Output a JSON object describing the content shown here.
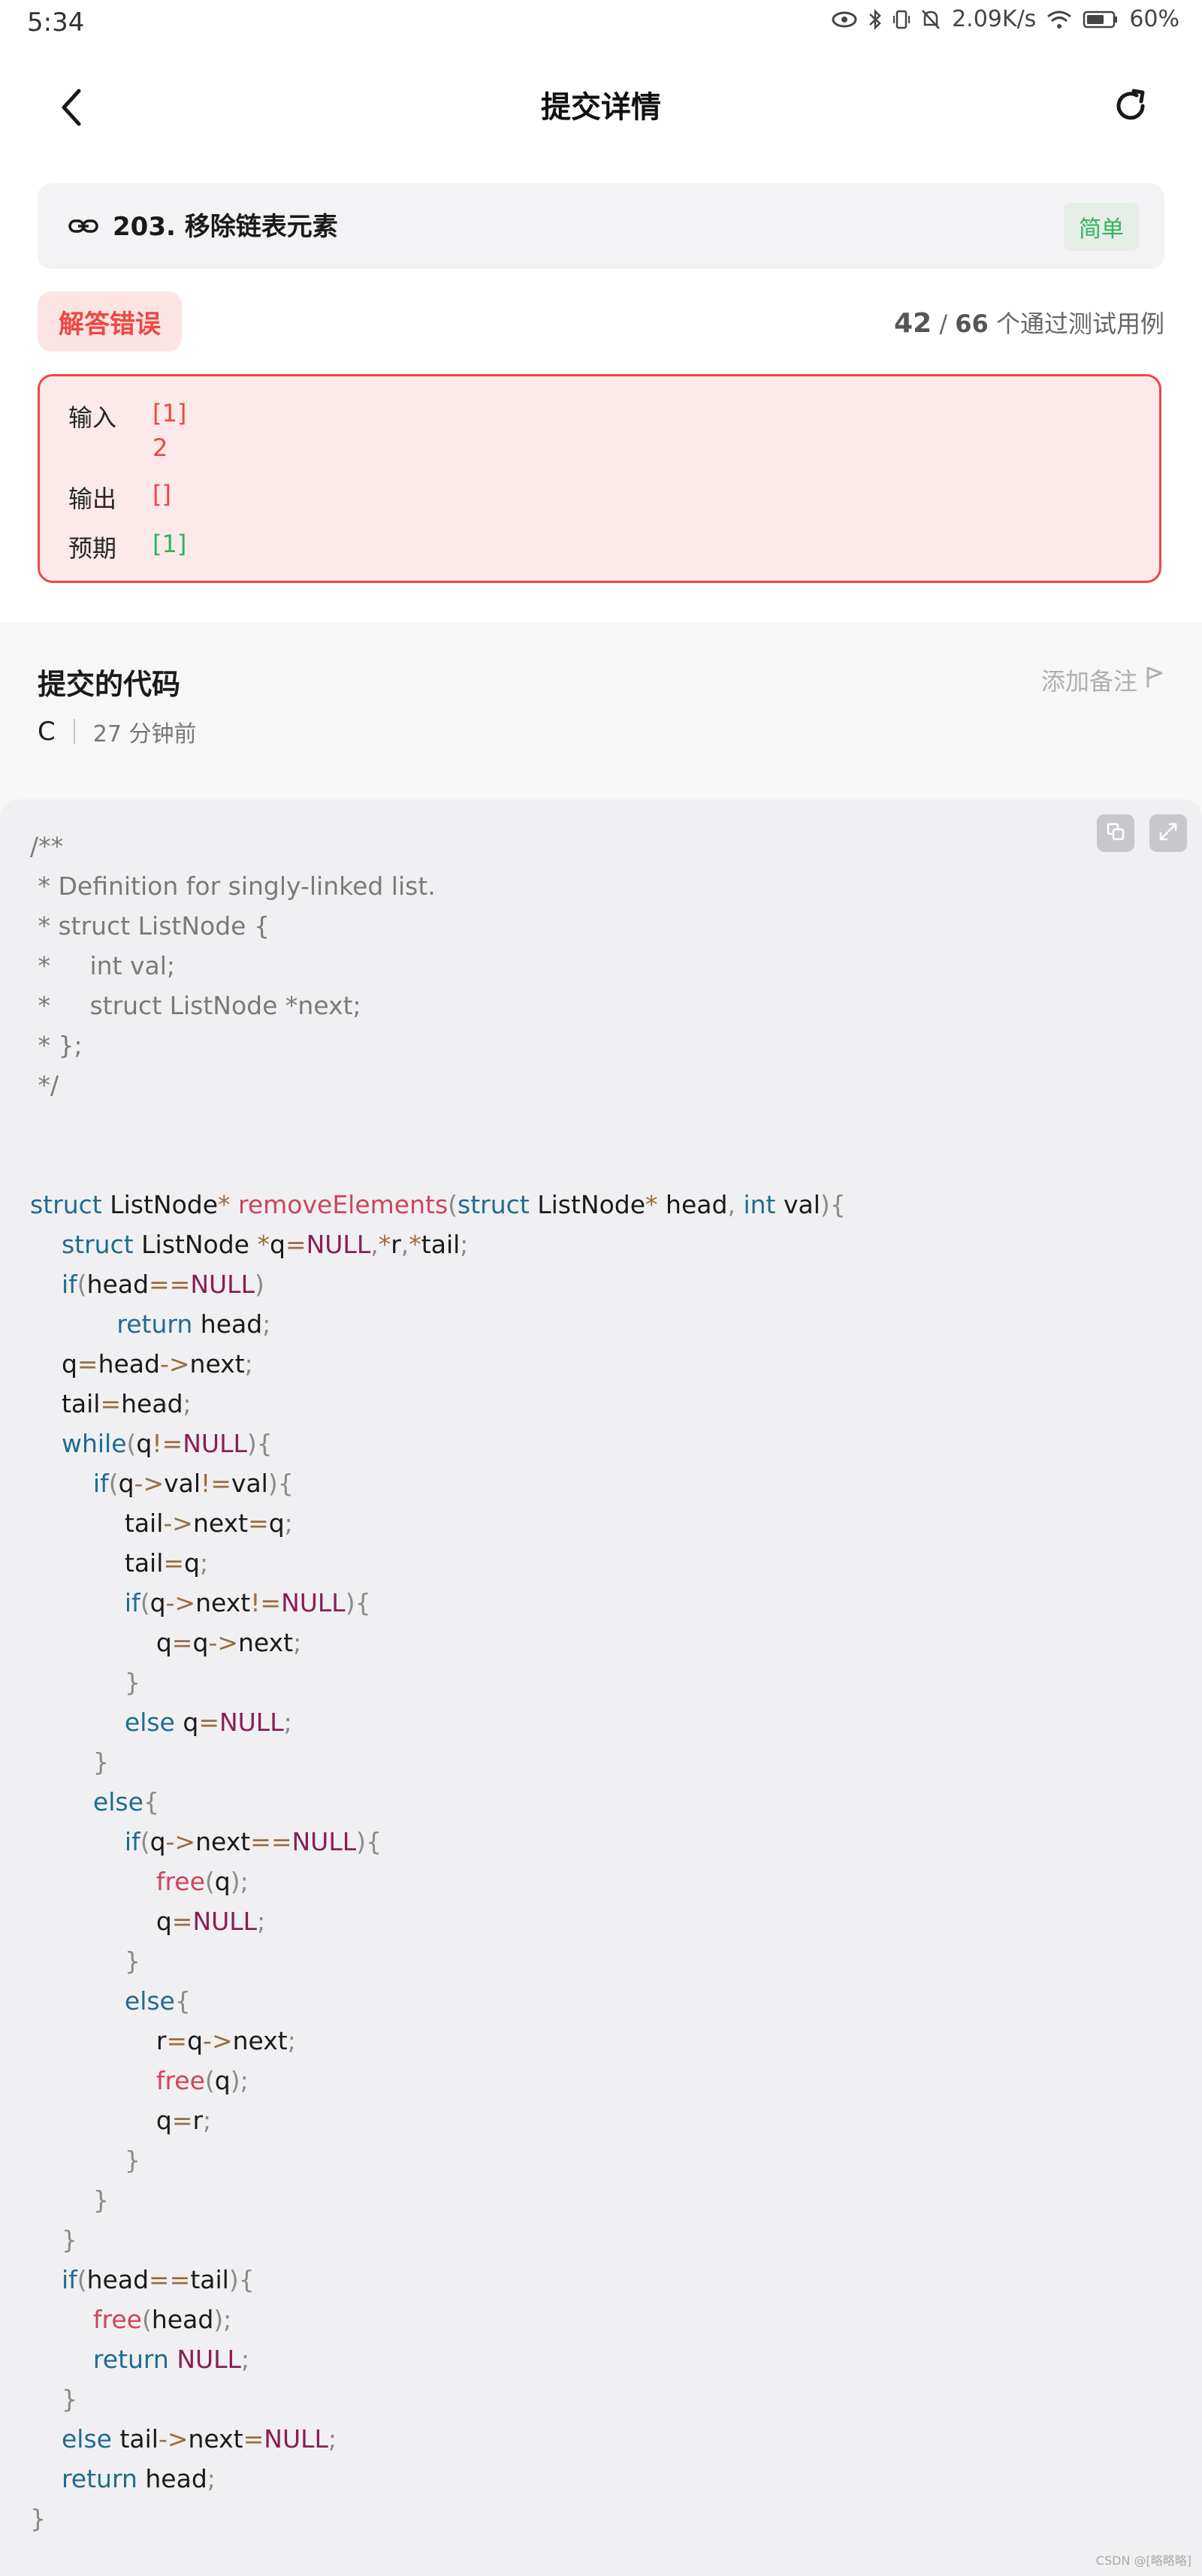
{
  "status_bar": {
    "time": "5:34",
    "network_speed": "2.09K/s",
    "battery": "60%",
    "icons": [
      "eye-icon",
      "bluetooth-icon",
      "vibrate-icon",
      "mute-icon",
      "wifi-icon",
      "battery-icon"
    ]
  },
  "header": {
    "title": "提交详情",
    "back_icon": "back-arrow-icon",
    "refresh_icon": "refresh-icon"
  },
  "problem": {
    "title": "203. 移除链表元素",
    "difficulty": "简单",
    "link_icon": "link-icon"
  },
  "result": {
    "status": "解答错误",
    "passed": "42",
    "total": "66",
    "pass_text": "个通过测试用例"
  },
  "testcase": {
    "input_label": "输入",
    "input_line1": "[1]",
    "input_line2": "2",
    "output_label": "输出",
    "output_value": "[]",
    "expected_label": "预期",
    "expected_value": "[1]"
  },
  "submission": {
    "heading": "提交的代码",
    "add_note": "添加备注",
    "language": "C",
    "time_ago": "27 分钟前"
  },
  "code": {
    "lines": [
      "/**",
      " * Definition for singly-linked list.",
      " * struct ListNode {",
      " *     int val;",
      " *     struct ListNode *next;",
      " * };",
      " */",
      "",
      "",
      "struct ListNode* removeElements(struct ListNode* head, int val){",
      "    struct ListNode *q=NULL,*r,*tail;",
      "    if(head==NULL)",
      "           return head;",
      "    q=head->next;",
      "    tail=head;",
      "    while(q!=NULL){",
      "        if(q->val!=val){",
      "            tail->next=q;",
      "            tail=q;",
      "            if(q->next!=NULL){",
      "                q=q->next;",
      "            }",
      "            else q=NULL;",
      "        }",
      "        else{",
      "            if(q->next==NULL){",
      "                free(q);",
      "                q=NULL;",
      "            }",
      "            else{",
      "                r=q->next;",
      "                free(q);",
      "                q=r;",
      "            }",
      "        }",
      "    }",
      "    if(head==tail){",
      "        free(head);",
      "        return NULL;",
      "    }",
      "    else tail->next=NULL;",
      "    return head;",
      "}"
    ]
  },
  "watermark": "CSDN @[略略略]",
  "colors": {
    "error_red": "#ef4743",
    "success_green": "#2db55d",
    "keyword": "#1f6c8f",
    "function": "#d1435b",
    "null_const": "#8a1d56",
    "comment": "#7a7a7a"
  }
}
